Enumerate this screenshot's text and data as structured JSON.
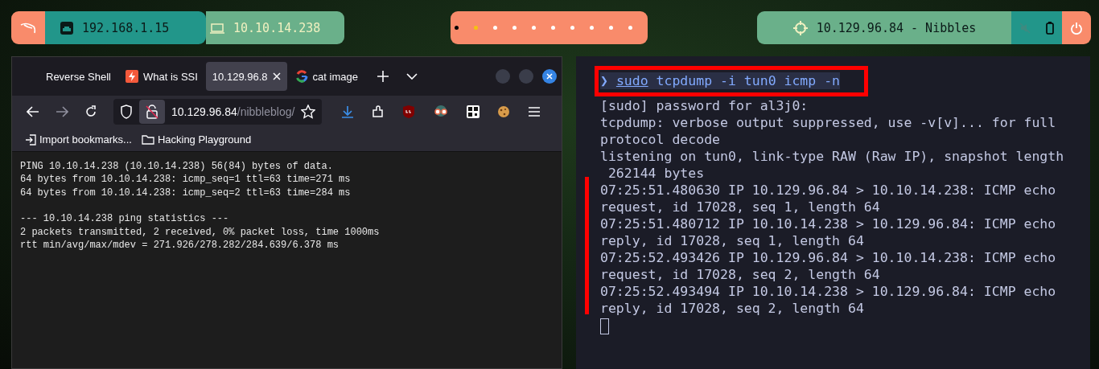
{
  "top_bar": {
    "network": [
      {
        "kind": "ethernet",
        "text": "192.168.1.15"
      },
      {
        "kind": "vpn",
        "text": "10.10.14.238"
      }
    ],
    "workspaces": [
      {
        "color": "#000000"
      },
      {
        "color": "#f5c211"
      },
      {
        "color": "#ffffff"
      },
      {
        "color": "#ffffff"
      },
      {
        "color": "#ffffff"
      },
      {
        "color": "#ffffff"
      },
      {
        "color": "#ffffff"
      },
      {
        "color": "#ffffff"
      },
      {
        "color": "#ffffff"
      },
      {
        "color": "#ffffff"
      }
    ],
    "target": "10.129.96.84 - Nibbles"
  },
  "browser": {
    "tabs": [
      {
        "title": "Reverse Shell",
        "kind": "plain",
        "selected": false
      },
      {
        "title": "What is SSI",
        "kind": "bolt",
        "selected": false
      },
      {
        "title": "10.129.96.8",
        "kind": "plain",
        "selected": true
      },
      {
        "title": "cat image",
        "kind": "google",
        "selected": false
      }
    ],
    "url": {
      "host": "10.129.96.84",
      "path": "/nibbleblog/"
    },
    "bookmarks": [
      {
        "kind": "import",
        "label": "Import bookmarks..."
      },
      {
        "kind": "folder",
        "label": "Hacking Playground"
      }
    ],
    "page_blocks": [
      [
        "PING 10.10.14.238 (10.10.14.238) 56(84) bytes of data.",
        "64 bytes from 10.10.14.238: icmp_seq=1 ttl=63 time=271 ms",
        "64 bytes from 10.10.14.238: icmp_seq=2 ttl=63 time=284 ms"
      ],
      [
        "--- 10.10.14.238 ping statistics ---",
        "2 packets transmitted, 2 received, 0% packet loss, time 1000ms",
        "rtt min/avg/max/mdev = 271.926/278.282/284.639/6.378 ms"
      ]
    ]
  },
  "terminal": {
    "prompt": "❯",
    "command": [
      {
        "text": "sudo",
        "underlined": true
      },
      {
        "text": "tcpdump -i tun0 icmp -n",
        "underlined": false
      }
    ],
    "output": [
      "[sudo] password for al3j0:",
      "tcpdump: verbose output suppressed, use -v[v]... for full",
      "protocol decode",
      "listening on tun0, link-type RAW (Raw IP), snapshot length",
      " 262144 bytes",
      "07:25:51.480630 IP 10.129.96.84 > 10.10.14.238: ICMP echo",
      "request, id 17028, seq 1, length 64",
      "07:25:51.480712 IP 10.10.14.238 > 10.129.96.84: ICMP echo",
      "reply, id 17028, seq 1, length 64",
      "07:25:52.493426 IP 10.129.96.84 > 10.10.14.238: ICMP echo",
      "request, id 17028, seq 2, length 64",
      "07:25:52.493494 IP 10.10.14.238 > 10.129.96.84: ICMP echo",
      "reply, id 17028, seq 2, length 64"
    ]
  }
}
